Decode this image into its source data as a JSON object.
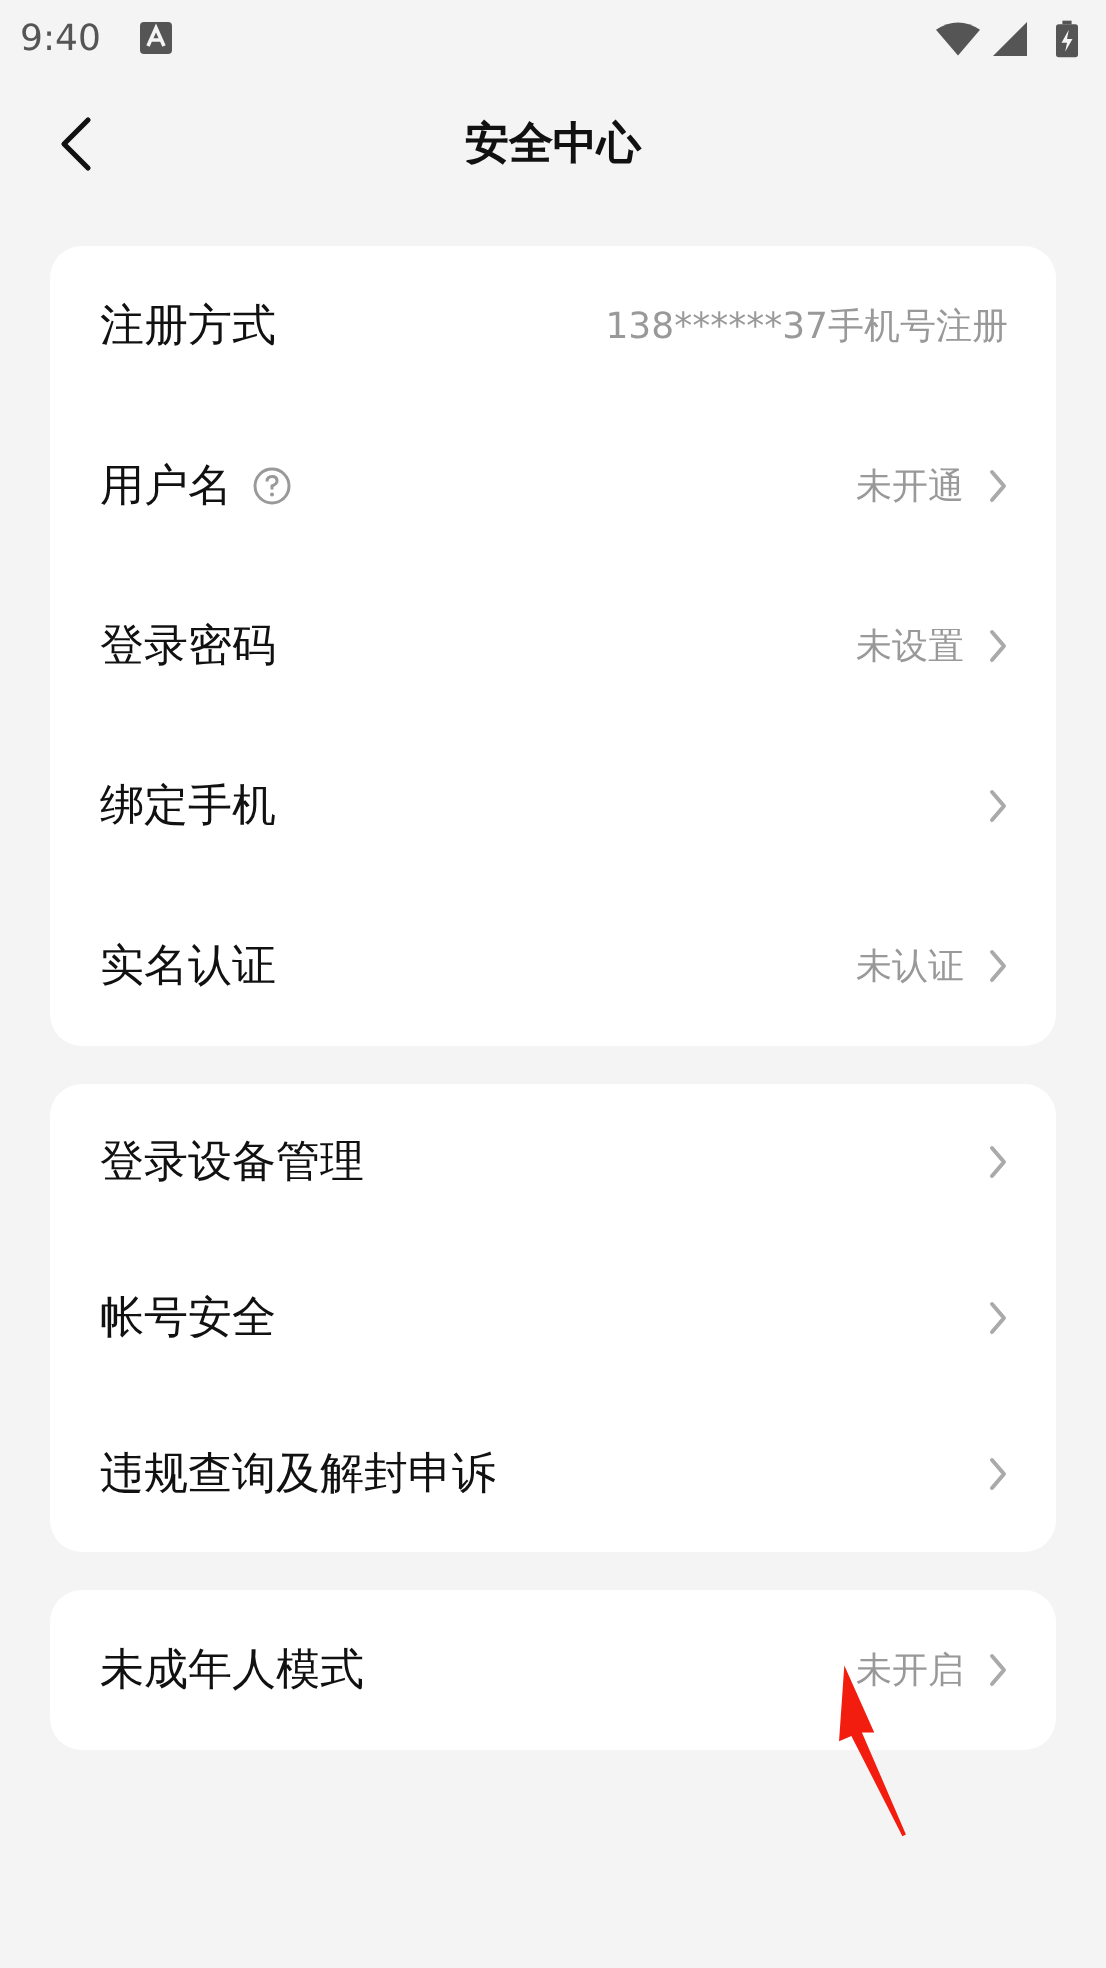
{
  "status_bar": {
    "time": "9:40"
  },
  "header": {
    "title": "安全中心"
  },
  "cards": [
    {
      "rows": [
        {
          "label": "注册方式",
          "value": "138******37手机号注册",
          "help": false,
          "chevron": false
        },
        {
          "label": "用户名",
          "value": "未开通",
          "help": true,
          "chevron": true
        },
        {
          "label": "登录密码",
          "value": "未设置",
          "help": false,
          "chevron": true
        },
        {
          "label": "绑定手机",
          "help": false,
          "chevron": true
        },
        {
          "label": "实名认证",
          "value": "未认证",
          "help": false,
          "chevron": true
        }
      ]
    },
    {
      "rows": [
        {
          "label": "登录设备管理",
          "help": false,
          "chevron": true
        },
        {
          "label": "帐号安全",
          "help": false,
          "chevron": true
        },
        {
          "label": "违规查询及解封申诉",
          "help": false,
          "chevron": true
        }
      ]
    },
    {
      "rows": [
        {
          "label": "未成年人模式",
          "value": "未开启",
          "help": false,
          "chevron": true
        }
      ]
    }
  ]
}
